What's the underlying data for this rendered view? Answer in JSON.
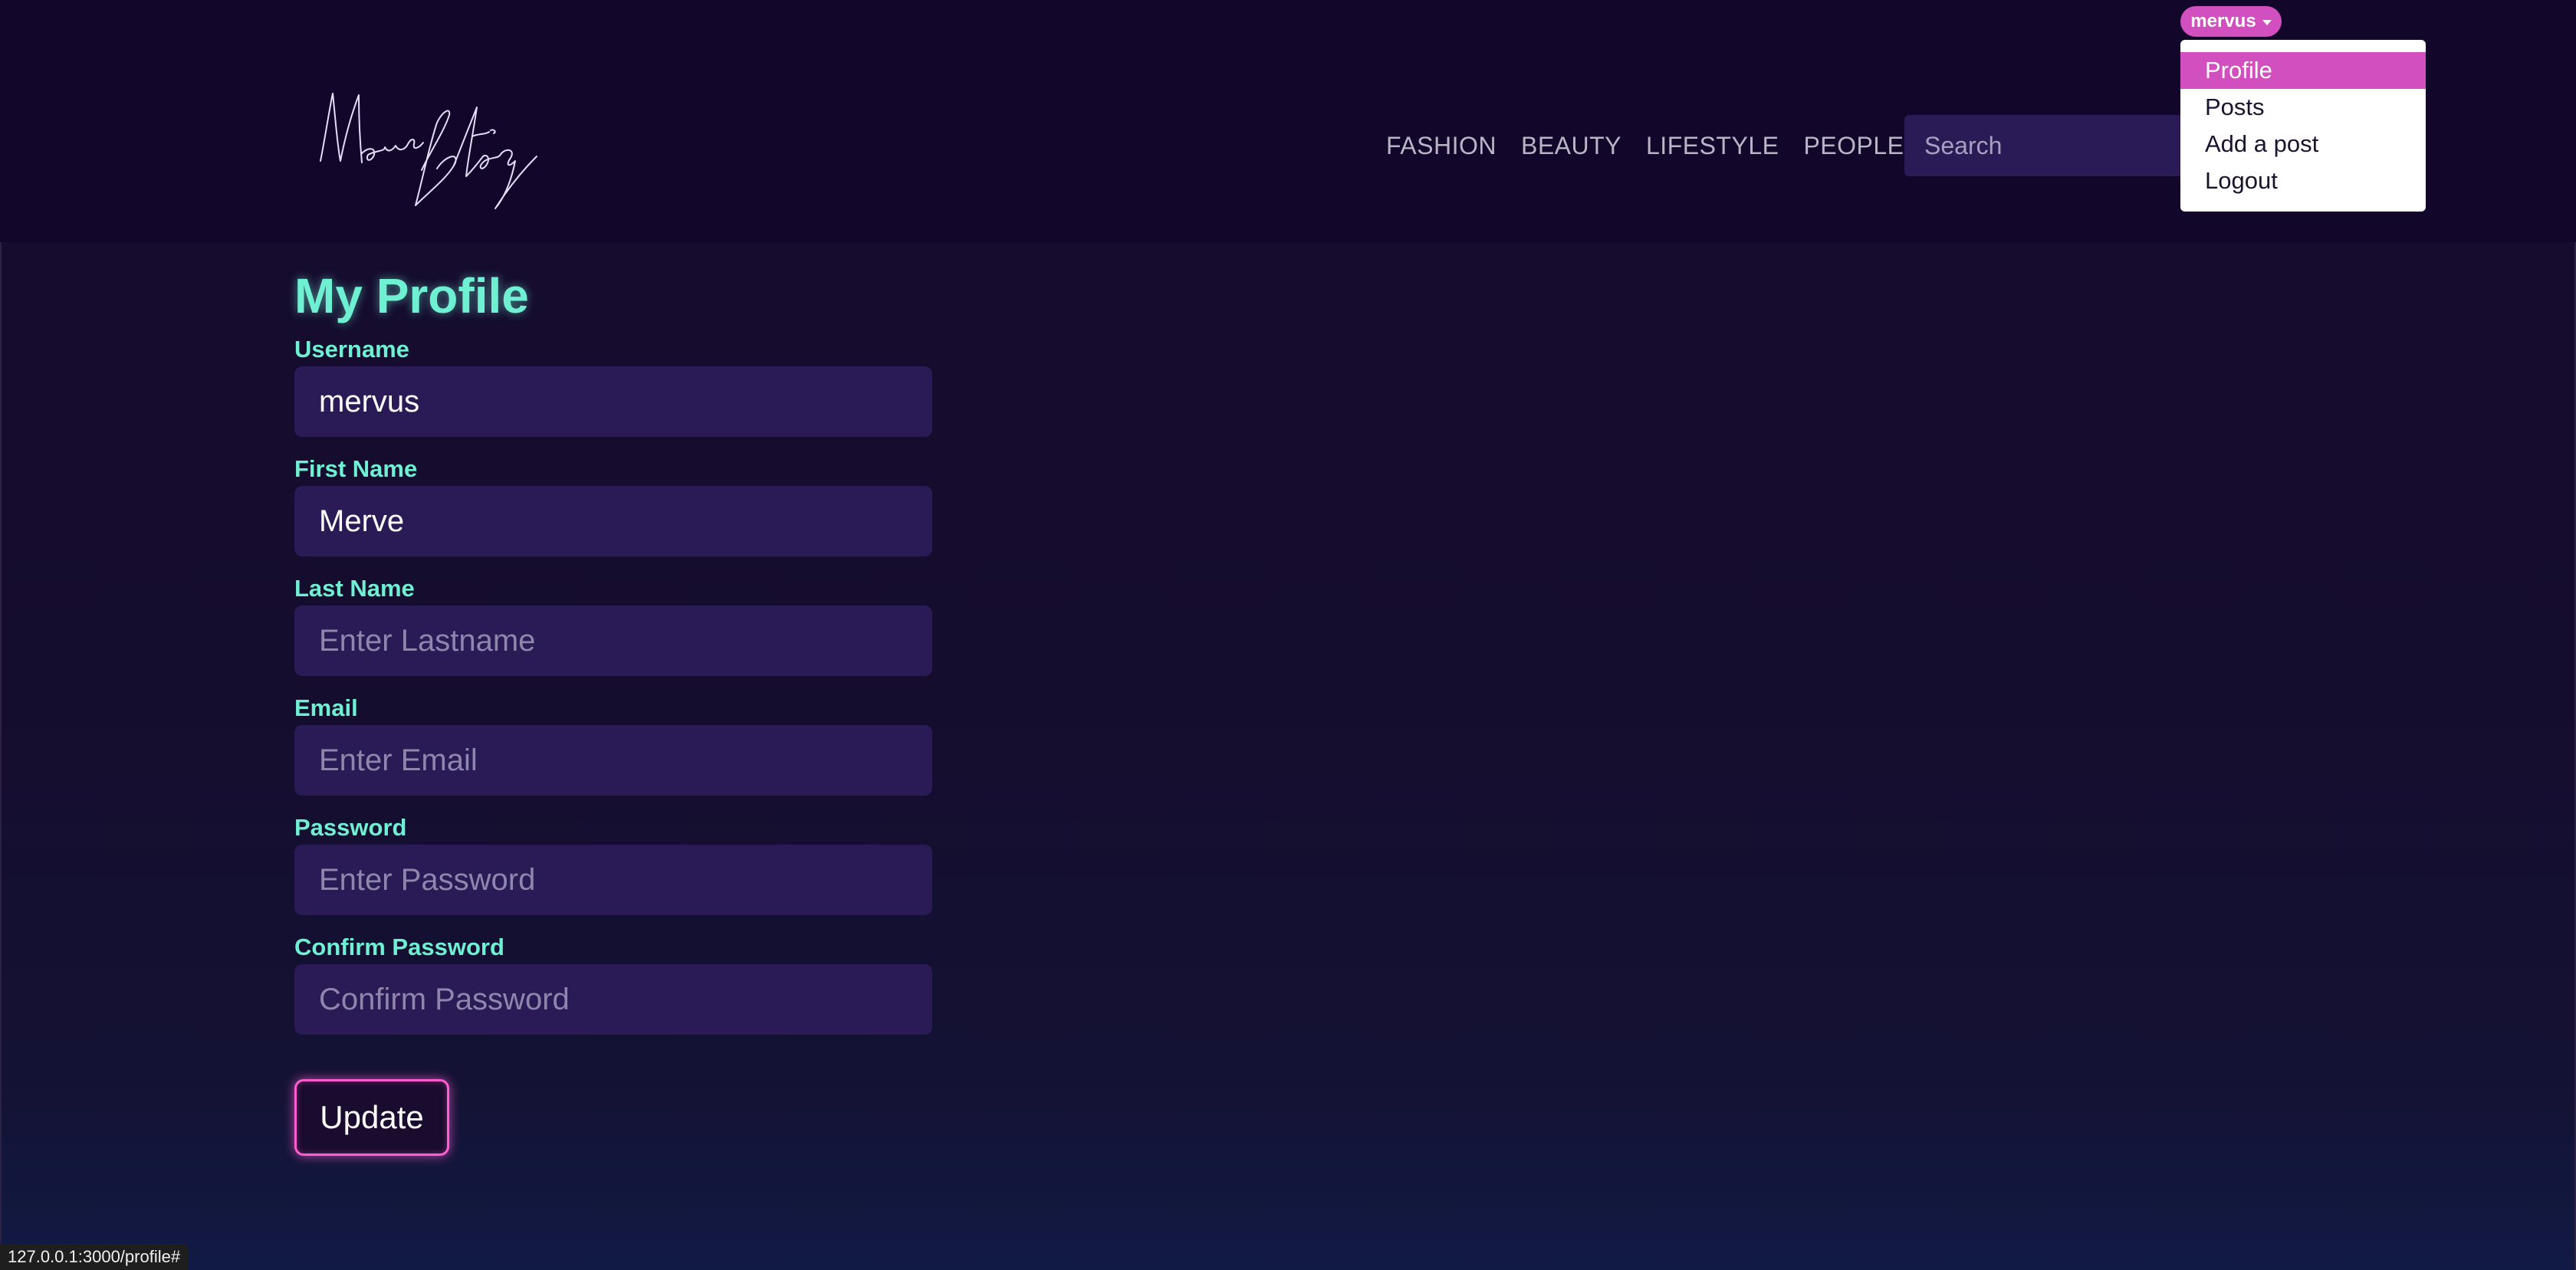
{
  "header": {
    "logo_text": "Merve Blog",
    "nav": [
      {
        "label": "FASHION"
      },
      {
        "label": "BEAUTY"
      },
      {
        "label": "LIFESTYLE"
      },
      {
        "label": "PEOPLE"
      }
    ],
    "search": {
      "placeholder": "Search",
      "value": ""
    }
  },
  "user_menu": {
    "username": "mervus",
    "items": [
      {
        "label": "Profile",
        "active": true
      },
      {
        "label": "Posts"
      },
      {
        "label": "Add a post"
      },
      {
        "label": "Logout"
      }
    ]
  },
  "profile": {
    "title": "My Profile",
    "fields": [
      {
        "label": "Username",
        "value": "mervus",
        "placeholder": ""
      },
      {
        "label": "First Name",
        "value": "Merve",
        "placeholder": ""
      },
      {
        "label": "Last Name",
        "value": "",
        "placeholder": "Enter Lastname"
      },
      {
        "label": "Email",
        "value": "",
        "placeholder": "Enter Email"
      },
      {
        "label": "Password",
        "value": "",
        "placeholder": "Enter Password"
      },
      {
        "label": "Confirm Password",
        "value": "",
        "placeholder": "Confirm Password"
      }
    ],
    "submit_label": "Update"
  },
  "status_bar": {
    "url": "127.0.0.1:3000/profile#"
  },
  "colors": {
    "accent_pink": "#d24fc0",
    "accent_teal": "#6ff0d2",
    "input_bg": "#2a1a56",
    "header_bg": "#12062a"
  }
}
